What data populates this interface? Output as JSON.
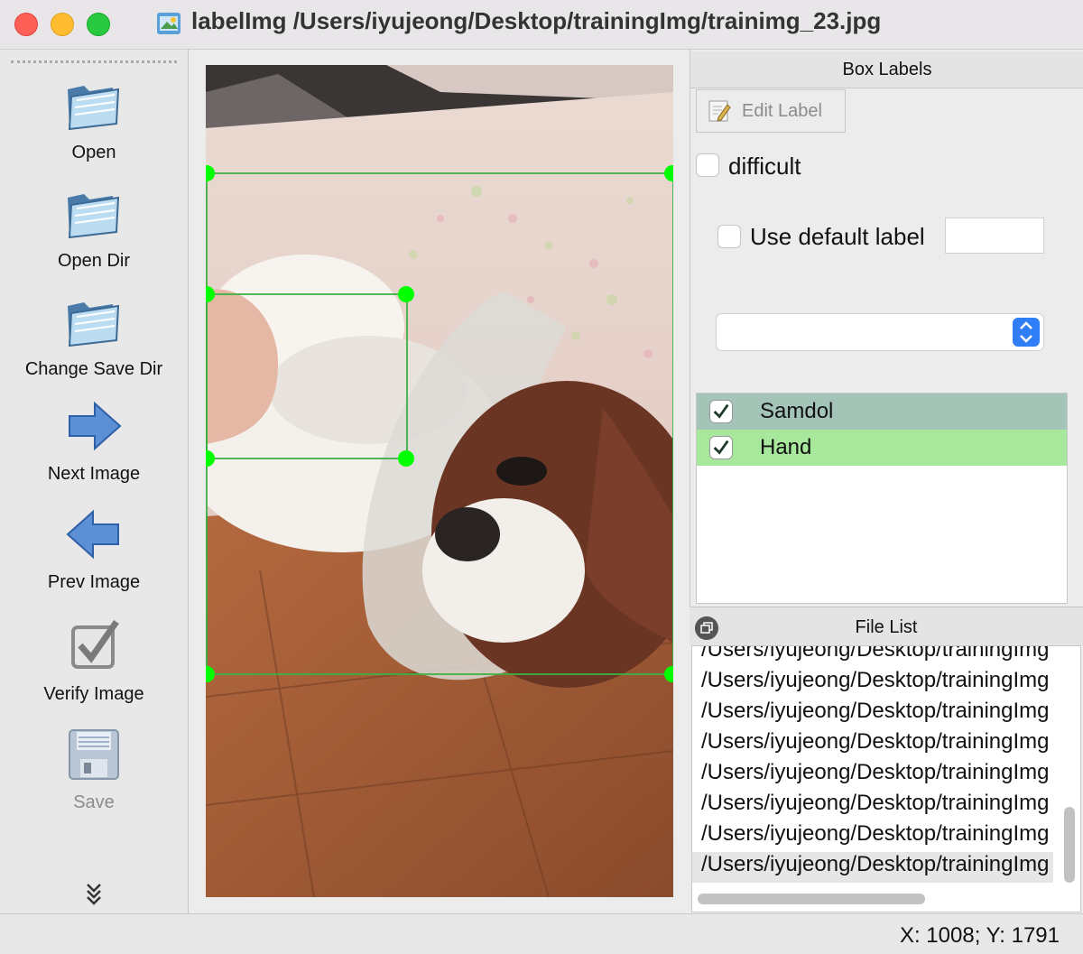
{
  "window": {
    "title": "labelImg /Users/iyujeong/Desktop/trainingImg/trainimg_23.jpg"
  },
  "toolbar": {
    "items": [
      {
        "label": "Open",
        "icon": "folder-open-icon",
        "enabled": true
      },
      {
        "label": "Open Dir",
        "icon": "folder-open-icon",
        "enabled": true
      },
      {
        "label": "Change Save Dir",
        "icon": "folder-open-icon",
        "enabled": true
      },
      {
        "label": "Next Image",
        "icon": "arrow-right-icon",
        "enabled": true
      },
      {
        "label": "Prev Image",
        "icon": "arrow-left-icon",
        "enabled": true
      },
      {
        "label": "Verify Image",
        "icon": "checkbox-icon",
        "enabled": true
      },
      {
        "label": "Save",
        "icon": "floppy-disk-icon",
        "enabled": false
      }
    ],
    "more_icon": "chevron-double-down-icon"
  },
  "canvas": {
    "image": "dog wearing cone with hand on wooden floor",
    "boxes": [
      {
        "label": "Samdol",
        "color": "#3cb043"
      },
      {
        "label": "Hand",
        "color": "#3cb043"
      }
    ],
    "handle_color": "#00ff00"
  },
  "box_labels": {
    "title": "Box Labels",
    "edit_label": "Edit Label",
    "difficult_label": "difficult",
    "difficult_checked": false,
    "use_default_label": "Use default label",
    "use_default_checked": false,
    "default_label_value": "",
    "combo_value": "",
    "labels": [
      {
        "name": "Samdol",
        "checked": true,
        "bg": "#a4c4b8"
      },
      {
        "name": "Hand",
        "checked": true,
        "bg": "#a8e89c"
      }
    ]
  },
  "file_list": {
    "title": "File List",
    "files": [
      "/Users/iyujeong/Desktop/trainingImg",
      "/Users/iyujeong/Desktop/trainingImg",
      "/Users/iyujeong/Desktop/trainingImg",
      "/Users/iyujeong/Desktop/trainingImg",
      "/Users/iyujeong/Desktop/trainingImg",
      "/Users/iyujeong/Desktop/trainingImg",
      "/Users/iyujeong/Desktop/trainingImg",
      "/Users/iyujeong/Desktop/trainingImg"
    ],
    "selected_index": 7
  },
  "status": {
    "text": "X: 1008; Y: 1791"
  }
}
